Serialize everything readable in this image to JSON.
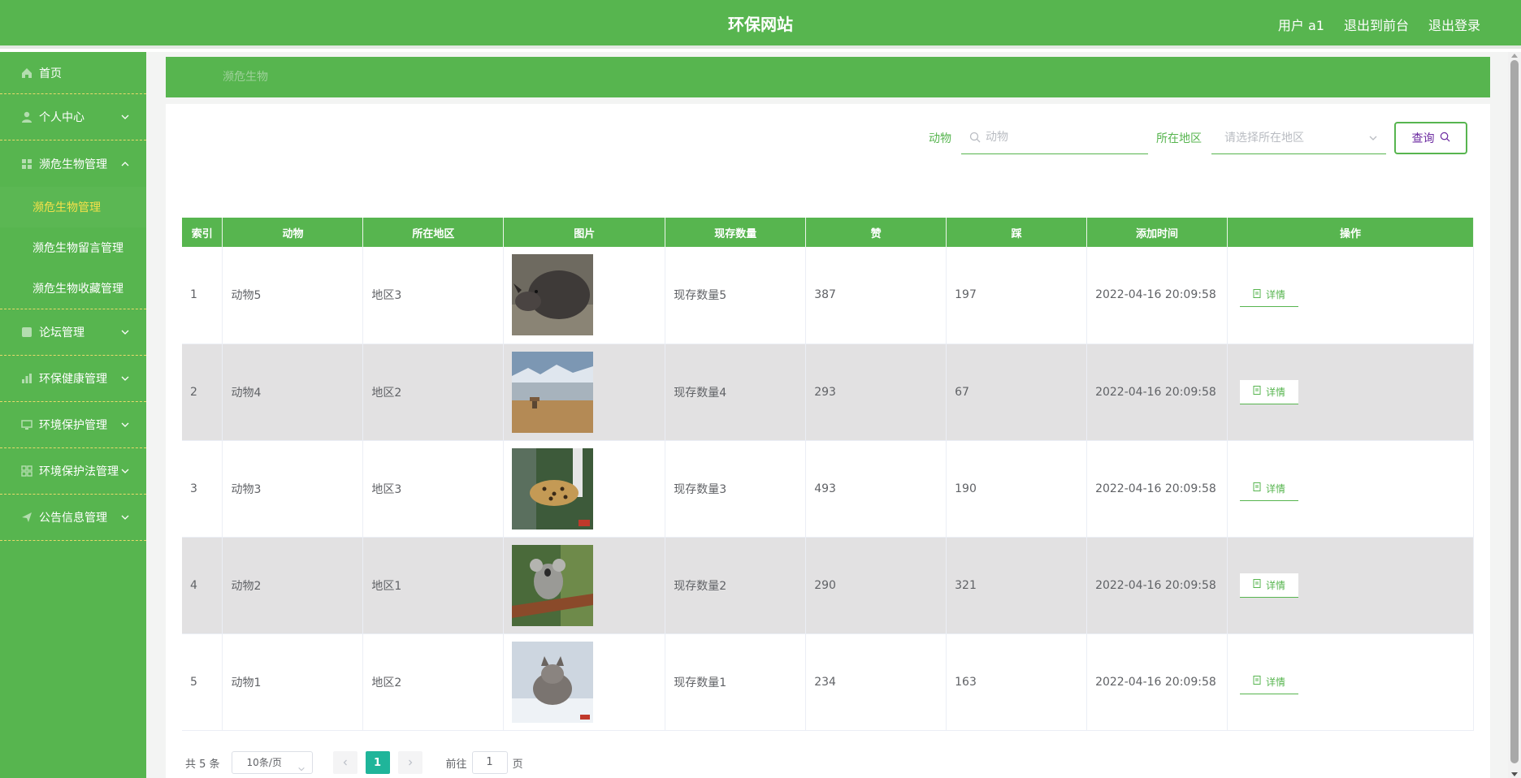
{
  "header": {
    "title": "环保网站",
    "user": "用户 a1",
    "to_front": "退出到前台",
    "logout": "退出登录"
  },
  "sidebar": {
    "items": [
      {
        "label": "首页",
        "icon": "home-icon"
      },
      {
        "label": "个人中心",
        "icon": "user-icon"
      },
      {
        "label": "濒危生物管理",
        "icon": "grid-icon",
        "expanded": true,
        "children": [
          "濒危生物管理",
          "濒危生物留言管理",
          "濒危生物收藏管理"
        ]
      },
      {
        "label": "论坛管理",
        "icon": "forum-icon"
      },
      {
        "label": "环保健康管理",
        "icon": "chart-icon"
      },
      {
        "label": "环境保护管理",
        "icon": "monitor-icon"
      },
      {
        "label": "环境保护法管理",
        "icon": "apps-icon"
      },
      {
        "label": "公告信息管理",
        "icon": "send-icon"
      }
    ]
  },
  "breadcrumb": "濒危生物",
  "search": {
    "animal_label": "动物",
    "animal_placeholder": "动物",
    "region_label": "所在地区",
    "region_placeholder": "请选择所在地区",
    "query_button": "查询"
  },
  "table": {
    "headers": [
      "索引",
      "动物",
      "所在地区",
      "图片",
      "现存数量",
      "赞",
      "踩",
      "添加时间",
      "操作"
    ],
    "detail_label": "详情",
    "rows": [
      {
        "index": "1",
        "animal": "动物5",
        "region": "地区3",
        "count": "现存数量5",
        "likes": "387",
        "dislikes": "197",
        "time": "2022-04-16 20:09:58",
        "image": "rhinoceros-photo"
      },
      {
        "index": "2",
        "animal": "动物4",
        "region": "地区2",
        "count": "现存数量4",
        "likes": "293",
        "dislikes": "67",
        "time": "2022-04-16 20:09:58",
        "image": "antelope-plain-photo"
      },
      {
        "index": "3",
        "animal": "动物3",
        "region": "地区3",
        "count": "现存数量3",
        "likes": "493",
        "dislikes": "190",
        "time": "2022-04-16 20:09:58",
        "image": "leopard-photo"
      },
      {
        "index": "4",
        "animal": "动物2",
        "region": "地区1",
        "count": "现存数量2",
        "likes": "290",
        "dislikes": "321",
        "time": "2022-04-16 20:09:58",
        "image": "koala-photo"
      },
      {
        "index": "5",
        "animal": "动物1",
        "region": "地区2",
        "count": "现存数量1",
        "likes": "234",
        "dislikes": "163",
        "time": "2022-04-16 20:09:58",
        "image": "fox-snow-photo"
      }
    ]
  },
  "pagination": {
    "total": "共 5 条",
    "page_size": "10条/页",
    "current": "1",
    "goto_prefix": "前往",
    "goto_value": "1",
    "goto_suffix": "页"
  },
  "colors": {
    "primary": "#57b54f",
    "active_menu_text": "#f5e14a",
    "page_active": "#1fb59a"
  }
}
